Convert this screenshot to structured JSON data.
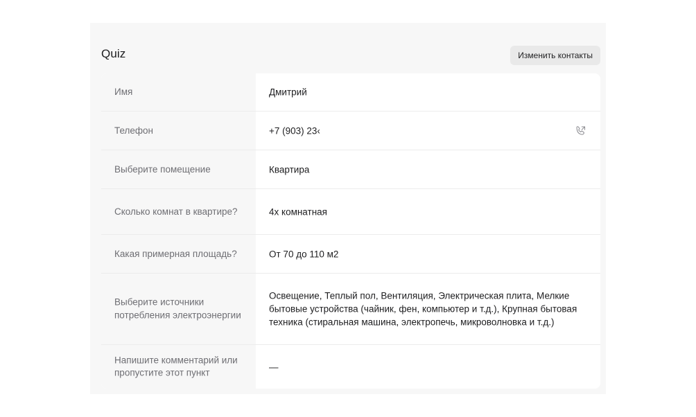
{
  "header": {
    "title": "Quiz",
    "edit_button": "Изменить контакты"
  },
  "rows": [
    {
      "label": "Имя",
      "value": "Дмитрий"
    },
    {
      "label": "Телефон",
      "value": "+7 (903) 23‹"
    },
    {
      "label": "Выберите помещение",
      "value": "Квартира"
    },
    {
      "label": "Сколько комнат в квартире?",
      "value": "4х комнатная"
    },
    {
      "label": "Какая примерная площадь?",
      "value": "От 70 до 110 м2"
    },
    {
      "label": "Выберите источники потребления электроэнергии",
      "value": "Освещение, Теплый пол, Вентиляция, Электрическая плита, Мелкие бытовые устройства (чайник, фен, компьютер и т.д.), Крупная бытовая техника (стиральная машина, электропечь, микроволновка и т.д.)"
    },
    {
      "label": "Напишите комментарий или пропустите этот пункт",
      "value": "—"
    }
  ],
  "icons": {
    "phone": "phone-call-icon"
  },
  "colors": {
    "panel_bg": "#f7f7f7",
    "card_bg": "#ffffff",
    "label_text": "#6e6e73",
    "value_text": "#1d1d1f",
    "button_bg": "#e9e9e9"
  }
}
